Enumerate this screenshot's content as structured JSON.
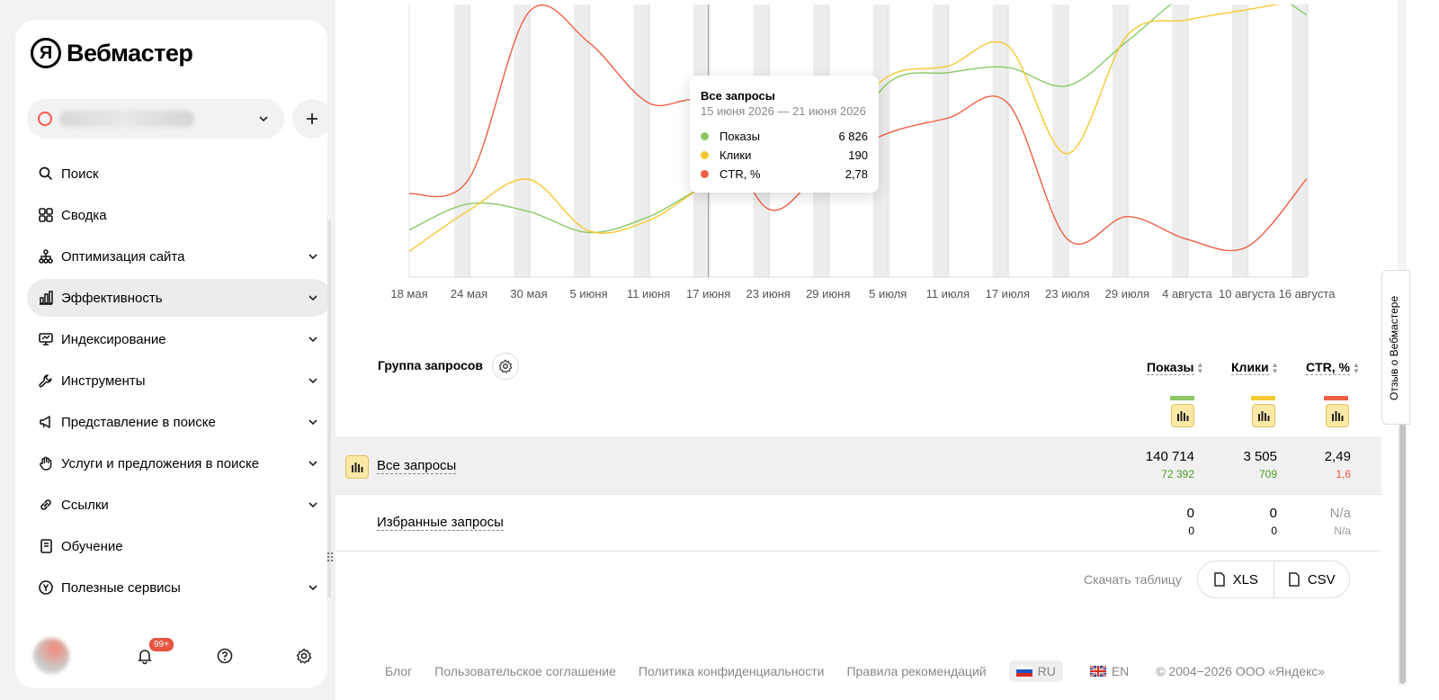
{
  "app": {
    "logo_mark": "Я",
    "logo_text": "Вебмастер"
  },
  "nav": [
    {
      "label": "Поиск",
      "icon": "search-icon",
      "expandable": false
    },
    {
      "label": "Сводка",
      "icon": "dashboard-icon",
      "expandable": false
    },
    {
      "label": "Оптимизация сайта",
      "icon": "sitemap-icon",
      "expandable": true
    },
    {
      "label": "Эффективность",
      "icon": "bar-chart-icon",
      "expandable": true,
      "active": true
    },
    {
      "label": "Индексирование",
      "icon": "monitor-icon",
      "expandable": true
    },
    {
      "label": "Инструменты",
      "icon": "wrench-icon",
      "expandable": true
    },
    {
      "label": "Представление в поиске",
      "icon": "megaphone-icon",
      "expandable": true
    },
    {
      "label": "Услуги и предложения в поиске",
      "icon": "hand-icon",
      "expandable": true
    },
    {
      "label": "Ссылки",
      "icon": "link-icon",
      "expandable": true
    },
    {
      "label": "Обучение",
      "icon": "book-icon",
      "expandable": false
    },
    {
      "label": "Полезные сервисы",
      "icon": "yandex-services-icon",
      "expandable": true
    }
  ],
  "notifications": {
    "badge": "99+"
  },
  "chart_data": {
    "type": "line",
    "x": [
      "18 мая",
      "24 мая",
      "30 мая",
      "5 июня",
      "11 июня",
      "17 июня",
      "23 июня",
      "29 июня",
      "5 июля",
      "11 июля",
      "17 июля",
      "23 июля",
      "29 июля",
      "4 августа",
      "10 августа",
      "16 августа"
    ],
    "series": [
      {
        "name": "Показы",
        "color": "#8cc866",
        "values": [
          5800,
          6800,
          6500,
          5700,
          6300,
          7500,
          7900,
          8100,
          11400,
          11800,
          12000,
          11300,
          13000,
          14800,
          15300,
          14000
        ]
      },
      {
        "name": "Клики",
        "color": "#f5c932",
        "values": [
          120,
          160,
          190,
          140,
          150,
          185,
          200,
          230,
          290,
          300,
          320,
          215,
          330,
          345,
          355,
          365
        ]
      },
      {
        "name": "CTR, %",
        "color": "#ee5f46",
        "values": [
          2.2,
          2.3,
          3.4,
          3.2,
          2.8,
          2.78,
          2.1,
          2.4,
          2.6,
          2.7,
          2.8,
          1.9,
          2.05,
          1.9,
          1.85,
          2.3
        ]
      }
    ],
    "grid": true,
    "highlight_index": 5
  },
  "tooltip": {
    "title": "Все запросы",
    "range": "15 июня 2026 — 21 июня 2026",
    "rows": [
      {
        "name": "Показы",
        "value": "6 826",
        "color": "#8cc866"
      },
      {
        "name": "Клики",
        "value": "190",
        "color": "#f5c932"
      },
      {
        "name": "CTR, %",
        "value": "2,78",
        "color": "#ee5f46"
      }
    ]
  },
  "table": {
    "group_title": "Группа запросов",
    "columns": [
      {
        "label": "Показы",
        "color": "#8cc866"
      },
      {
        "label": "Клики",
        "color": "#f5c932"
      },
      {
        "label": "CTR, %",
        "color": "#ee5f46"
      }
    ],
    "rows": [
      {
        "label": "Все запросы",
        "values": [
          "140 714",
          "3 505",
          "2,49"
        ],
        "deltas": [
          "72 392",
          "709",
          "1,6"
        ],
        "delta_colors": [
          "#4a9a2a",
          "#4a9a2a",
          "#e9533f"
        ]
      },
      {
        "label": "Избранные запросы",
        "values": [
          "0",
          "0",
          "N/a"
        ],
        "deltas": [
          "0",
          "0",
          "N/a"
        ],
        "delta_colors": [
          "#000",
          "#000",
          "#999"
        ]
      }
    ],
    "download_label": "Скачать таблицу",
    "download_xls": "XLS",
    "download_csv": "CSV"
  },
  "footer": {
    "links": [
      "Блог",
      "Пользовательское соглашение",
      "Политика конфиденциальности",
      "Правила рекомендаций"
    ],
    "lang_ru": "RU",
    "lang_en": "EN",
    "copyright": "© 2004−2026 ООО «Яндекс»"
  },
  "feedback_tab": "Отзыв о Вебмастере"
}
